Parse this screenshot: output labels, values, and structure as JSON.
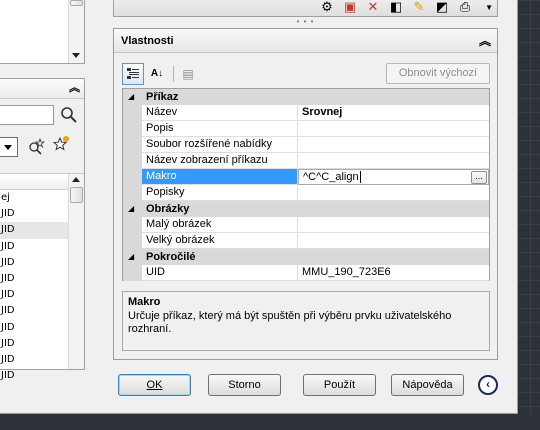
{
  "left_list": {
    "rows": [
      "ej",
      "JID",
      "JID",
      "JID",
      "JID",
      "JID",
      "JID",
      "JID",
      "JID",
      "JID",
      "JID",
      "JID"
    ],
    "selected_index": 2
  },
  "properties": {
    "title": "Vlastnosti",
    "reset_button": "Obnovit výchozí",
    "categories": [
      {
        "label": "Příkaz",
        "rows": [
          {
            "name": "Název",
            "value": "Srovnej",
            "bold": true
          },
          {
            "name": "Popis",
            "value": ""
          },
          {
            "name": "Soubor rozšířené nabídky",
            "value": ""
          },
          {
            "name": "Název zobrazení příkazu",
            "value": ""
          },
          {
            "name": "Makro",
            "value": "^C^C_align",
            "selected": true
          },
          {
            "name": "Popisky",
            "value": ""
          }
        ]
      },
      {
        "label": "Obrázky",
        "rows": [
          {
            "name": "Malý obrázek",
            "value": ""
          },
          {
            "name": "Velký obrázek",
            "value": ""
          }
        ]
      },
      {
        "label": "Pokročilé",
        "rows": [
          {
            "name": "UID",
            "value": "MMU_190_723E6"
          }
        ]
      }
    ],
    "description": {
      "title": "Makro",
      "text": "Určuje příkaz, který má být spuštěn při výběru prvku uživatelského rozhraní."
    }
  },
  "buttons": {
    "ok": "OK",
    "cancel": "Storno",
    "apply": "Použít",
    "help": "Nápověda"
  },
  "icons": {
    "toggle_collapse": "collapse-up-icon",
    "info": "info-arrow-icon"
  },
  "colors": {
    "selection": "#3399ff",
    "category_bg": "#d9d9d9"
  }
}
